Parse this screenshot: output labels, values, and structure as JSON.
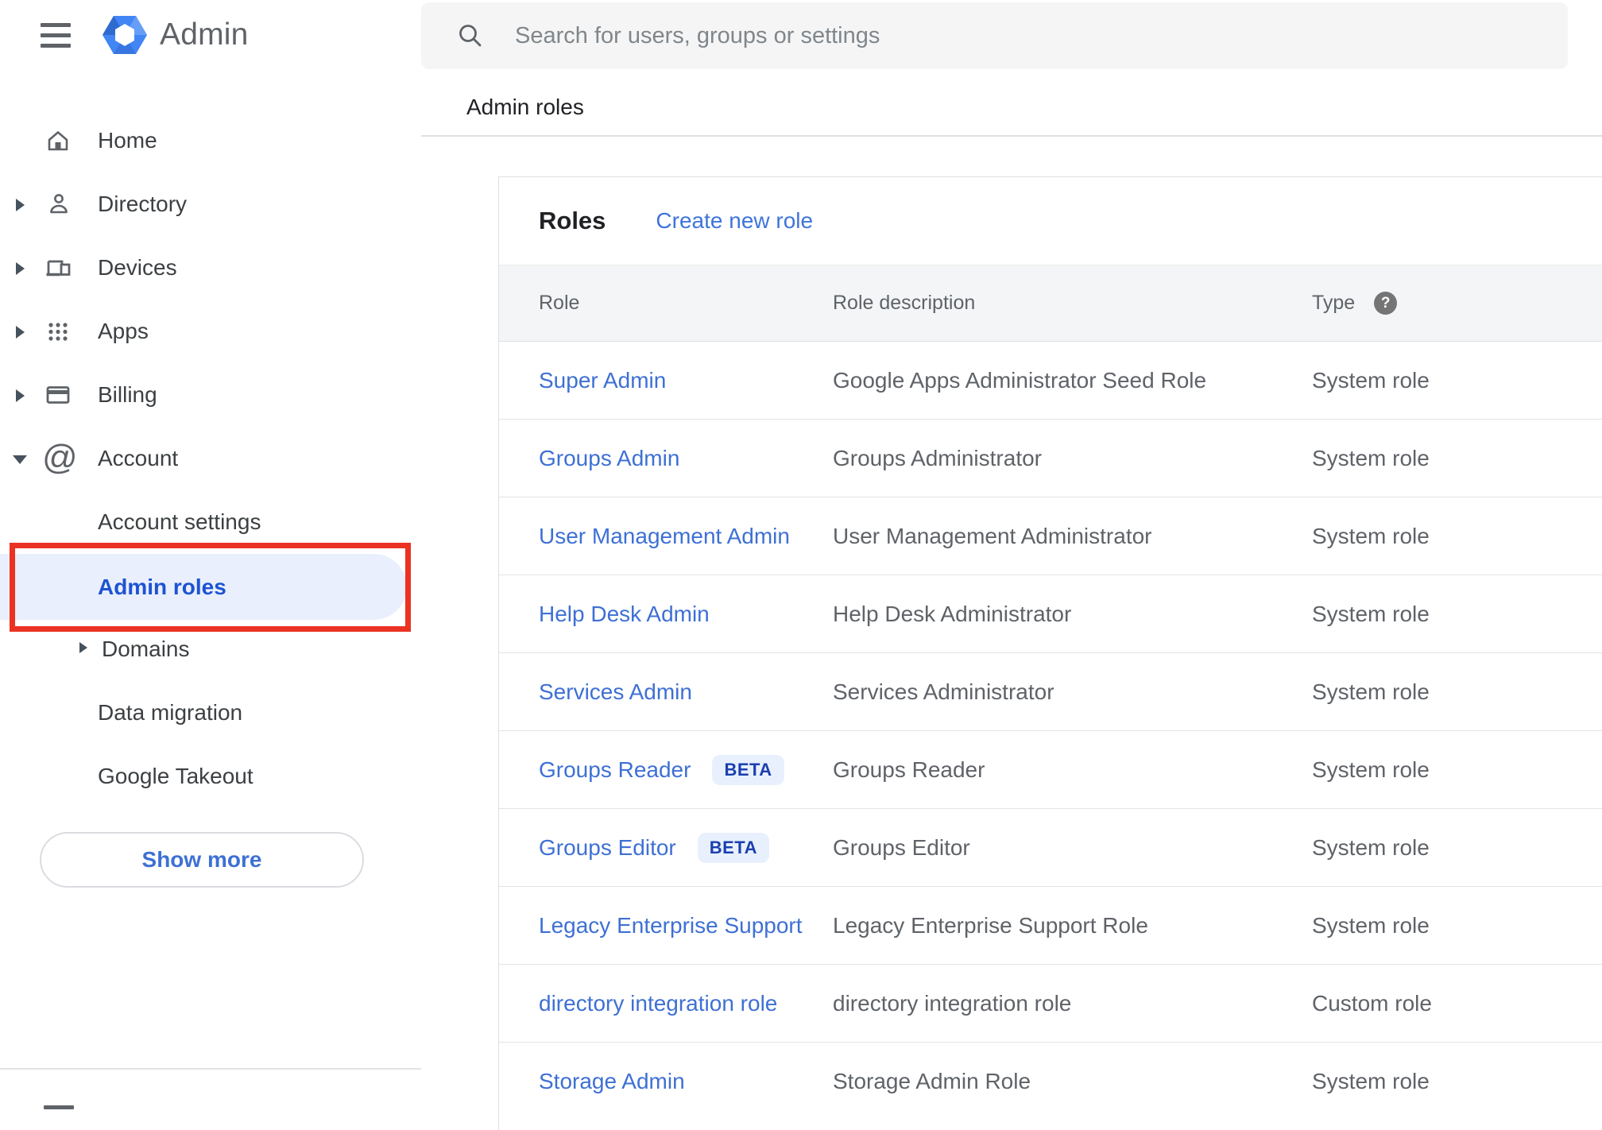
{
  "app": {
    "title": "Admin"
  },
  "search": {
    "placeholder": "Search for users, groups or settings"
  },
  "breadcrumb": {
    "label": "Admin roles"
  },
  "sidebar": {
    "items": [
      {
        "label": "Home",
        "icon": "home-icon",
        "expandable": false
      },
      {
        "label": "Directory",
        "icon": "person-icon",
        "expandable": true
      },
      {
        "label": "Devices",
        "icon": "devices-icon",
        "expandable": true
      },
      {
        "label": "Apps",
        "icon": "apps-grid-icon",
        "expandable": true
      },
      {
        "label": "Billing",
        "icon": "credit-card-icon",
        "expandable": true
      },
      {
        "label": "Account",
        "icon": "at-sign-icon",
        "expandable": true,
        "expanded": true
      }
    ],
    "account_children": [
      {
        "label": "Account settings",
        "selected": false
      },
      {
        "label": "Admin roles",
        "selected": true
      },
      {
        "label": "Domains",
        "expandable": true,
        "selected": false
      },
      {
        "label": "Data migration",
        "selected": false
      },
      {
        "label": "Google Takeout",
        "selected": false
      }
    ],
    "show_more_label": "Show more"
  },
  "roles_panel": {
    "title": "Roles",
    "create_link": "Create new role",
    "columns": [
      "Role",
      "Role description",
      "Type"
    ],
    "rows": [
      {
        "role": "Super Admin",
        "description": "Google Apps Administrator Seed Role",
        "type": "System role"
      },
      {
        "role": "Groups Admin",
        "description": "Groups Administrator",
        "type": "System role"
      },
      {
        "role": "User Management Admin",
        "description": "User Management Administrator",
        "type": "System role"
      },
      {
        "role": "Help Desk Admin",
        "description": "Help Desk Administrator",
        "type": "System role"
      },
      {
        "role": "Services Admin",
        "description": "Services Administrator",
        "type": "System role"
      },
      {
        "role": "Groups Reader",
        "badge": "BETA",
        "description": "Groups Reader",
        "type": "System role"
      },
      {
        "role": "Groups Editor",
        "badge": "BETA",
        "description": "Groups Editor",
        "type": "System role"
      },
      {
        "role": "Legacy Enterprise Support",
        "description": "Legacy Enterprise Support Role",
        "type": "System role"
      },
      {
        "role": "directory integration role",
        "description": "directory integration role",
        "type": "Custom role"
      },
      {
        "role": "Storage Admin",
        "description": "Storage Admin Role",
        "type": "System role"
      }
    ]
  },
  "colors": {
    "link_blue": "#3e70d4",
    "selected_nav_blue": "#1d53d3",
    "annotation_red": "#ea3323",
    "beta_badge_bg": "#e8f0fe",
    "beta_badge_text": "#1b3fae",
    "selected_pill_bg": "#e9effc"
  }
}
